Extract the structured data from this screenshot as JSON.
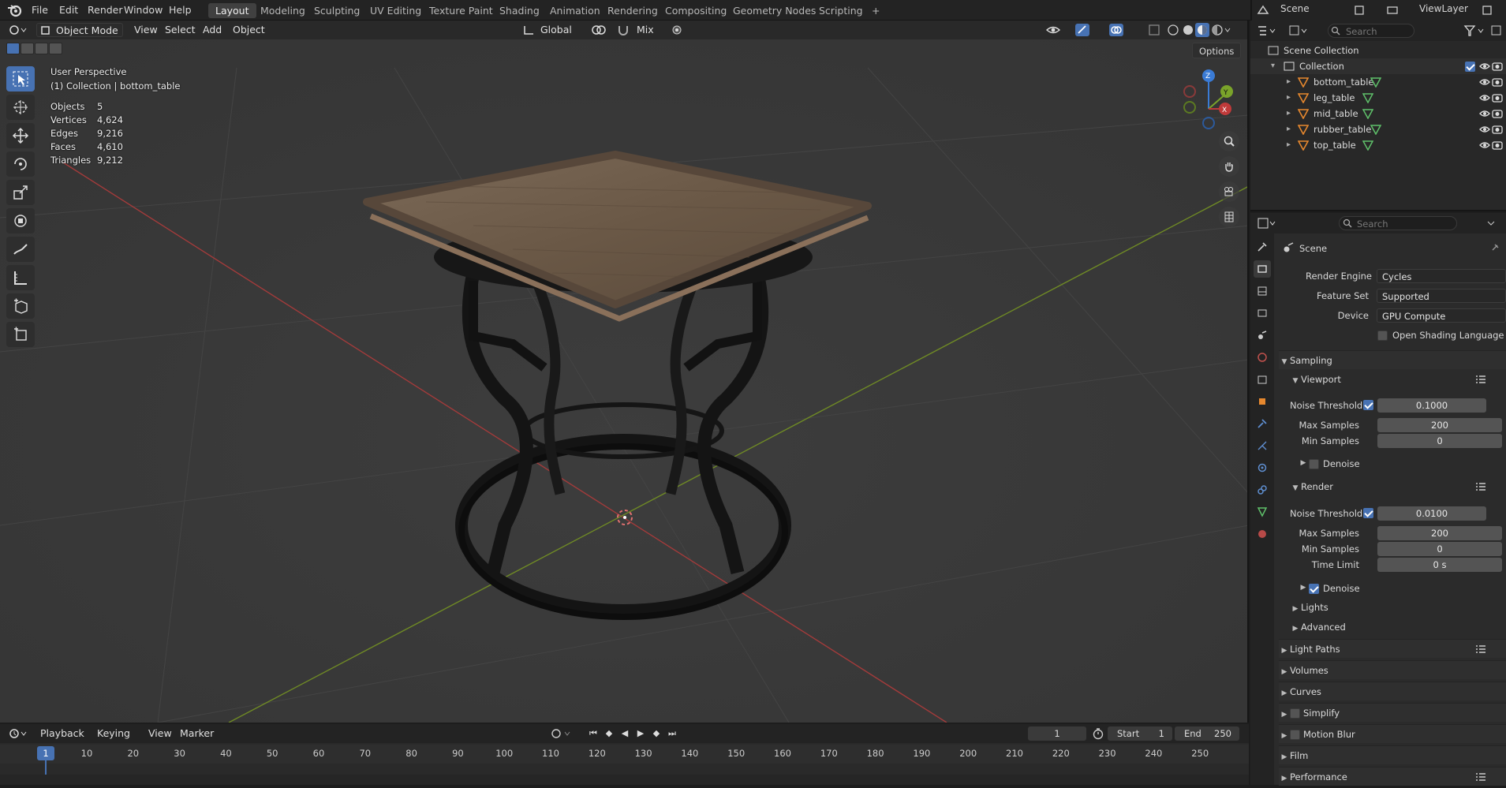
{
  "top_menu": [
    "File",
    "Edit",
    "Render",
    "Window",
    "Help"
  ],
  "workspaces": [
    "Layout",
    "Modeling",
    "Sculpting",
    "UV Editing",
    "Texture Paint",
    "Shading",
    "Animation",
    "Rendering",
    "Compositing",
    "Geometry Nodes",
    "Scripting"
  ],
  "active_workspace": "Layout",
  "add_workspace": "+",
  "scene_name": "Scene",
  "view_layer": "ViewLayer",
  "viewport": {
    "mode": "Object Mode",
    "menus": [
      "View",
      "Select",
      "Add",
      "Object"
    ],
    "orientation": "Global",
    "snap_mode": "Mix",
    "options": "Options",
    "perspective": "User Perspective",
    "context": "(1) Collection | bottom_table",
    "stats": [
      {
        "k": "Objects",
        "v": "5"
      },
      {
        "k": "Vertices",
        "v": "4,624"
      },
      {
        "k": "Edges",
        "v": "9,216"
      },
      {
        "k": "Faces",
        "v": "4,610"
      },
      {
        "k": "Triangles",
        "v": "9,212"
      }
    ],
    "gizmo": {
      "z": "Z",
      "y": "Y",
      "x": "X"
    }
  },
  "outliner": {
    "search_placeholder": "Search",
    "scene_collection": "Scene Collection",
    "collection": "Collection",
    "objects": [
      "bottom_table",
      "leg_table",
      "mid_table",
      "rubber_table",
      "top_table"
    ]
  },
  "properties": {
    "search_placeholder": "Search",
    "context": "Scene",
    "render_engine_label": "Render Engine",
    "render_engine": "Cycles",
    "feature_set_label": "Feature Set",
    "feature_set": "Supported",
    "device_label": "Device",
    "device": "GPU Compute",
    "osl_label": "Open Shading Language",
    "sampling": "Sampling",
    "viewport_sub": "Viewport",
    "noise_threshold_label": "Noise Threshold",
    "viewport_noise": "0.1000",
    "max_samples_label": "Max Samples",
    "viewport_max": "200",
    "min_samples_label": "Min Samples",
    "viewport_min": "0",
    "denoise_label": "Denoise",
    "render_sub": "Render",
    "render_noise": "0.0100",
    "render_max": "200",
    "render_min": "0",
    "time_limit_label": "Time Limit",
    "time_limit": "0 s",
    "lights": "Lights",
    "advanced": "Advanced",
    "light_paths": "Light Paths",
    "volumes": "Volumes",
    "curves": "Curves",
    "simplify": "Simplify",
    "motion_blur": "Motion Blur",
    "film": "Film",
    "performance": "Performance"
  },
  "timeline": {
    "menus": [
      "Playback",
      "Keying",
      "View",
      "Marker"
    ],
    "current_frame": "1",
    "start_label": "Start",
    "start": "1",
    "end_label": "End",
    "end": "250",
    "ruler": [
      "1",
      "10",
      "20",
      "30",
      "40",
      "50",
      "60",
      "70",
      "80",
      "90",
      "100",
      "110",
      "120",
      "130",
      "140",
      "150",
      "160",
      "170",
      "180",
      "190",
      "200",
      "210",
      "220",
      "230",
      "240",
      "250"
    ]
  },
  "colors": {
    "accent": "#4772b3",
    "x_axis": "#c44",
    "y_axis": "#7a9a2a",
    "wood": "#6d5a48",
    "metal": "#1a1a1a"
  }
}
